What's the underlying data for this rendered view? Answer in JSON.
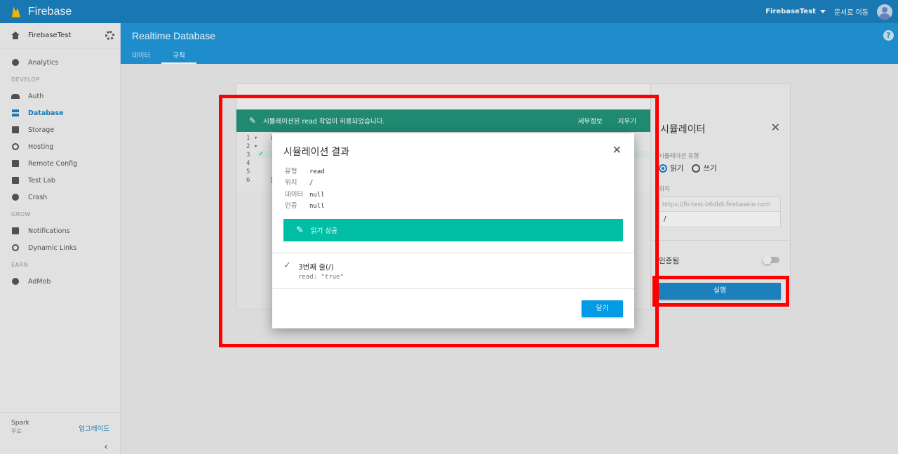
{
  "topbar": {
    "brand": "Firebase",
    "project": "FirebaseTest",
    "docs_link": "문서로 이동"
  },
  "sidebar": {
    "project_name": "FirebaseTest",
    "items_top": [
      {
        "label": "Analytics"
      }
    ],
    "section_develop": "DEVELOP",
    "items_develop": [
      {
        "label": "Auth"
      },
      {
        "label": "Database"
      },
      {
        "label": "Storage"
      },
      {
        "label": "Hosting"
      },
      {
        "label": "Remote Config"
      },
      {
        "label": "Test Lab"
      },
      {
        "label": "Crash"
      }
    ],
    "section_grow": "GROW",
    "items_grow": [
      {
        "label": "Notifications"
      },
      {
        "label": "Dynamic Links"
      }
    ],
    "section_earn": "EARN",
    "items_earn": [
      {
        "label": "AdMob"
      }
    ],
    "plan": "Spark",
    "plan_sub": "무료",
    "upgrade": "업그레이드",
    "collapse": "‹"
  },
  "header": {
    "title": "Realtime Database",
    "tabs": [
      {
        "label": "데이터"
      },
      {
        "label": "규칙"
      }
    ],
    "help": "?"
  },
  "banner": {
    "message": "시뮬레이션된 read 작업이 허용되었습니다.",
    "details": "세부정보",
    "clear": "지우기"
  },
  "editor": {
    "line_numbers": [
      "1 ▾",
      "2 ▾",
      "3",
      "4",
      "5",
      "6"
    ],
    "line1_text": "{",
    "line6_text": "}"
  },
  "simulator": {
    "title": "시뮬레이터",
    "type_label": "시뮬레이션 유형",
    "read": "읽기",
    "write": "쓰기",
    "location_label": "위치",
    "url": "https://fir-test-b6db6.firebaseio.com",
    "path": "/",
    "auth_label": "인증됨",
    "run": "실행"
  },
  "dialog": {
    "title": "시뮬레이션 결과",
    "fields": [
      {
        "key": "유형",
        "value": "read"
      },
      {
        "key": "위치",
        "value": "/"
      },
      {
        "key": "데이터",
        "value": "null"
      },
      {
        "key": "인증",
        "value": "null"
      }
    ],
    "success": "읽기 성공",
    "result_line": "3번째 줄(/)",
    "result_detail": "read: \"true\"",
    "close": "닫기"
  },
  "colors": {
    "topbar": "#1b7fbe",
    "header": "#2196d9",
    "success": "#00bfa5",
    "banner": "#22927a",
    "annotation": "#ff0000"
  }
}
